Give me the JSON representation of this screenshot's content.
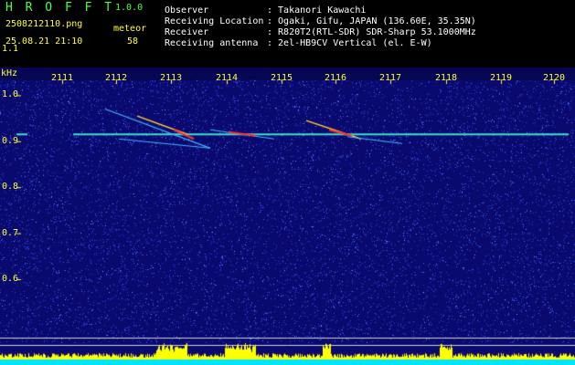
{
  "header": {
    "brand": "H R O F F T",
    "version": "1.0.0",
    "filename": "2508212110.png",
    "timestamp": "25.08.21 21:10",
    "type_label": "meteor",
    "count": "58",
    "info": [
      {
        "label": "Observer",
        "value": ": Takanori Kawachi"
      },
      {
        "label": "Receiving Location",
        "value": ": Ogaki, Gifu, JAPAN (136.60E, 35.35N)"
      },
      {
        "label": "Receiver",
        "value": ": R820T2(RTL-SDR) SDR-Sharp 53.1000MHz"
      },
      {
        "label": "Receiving antenna",
        "value": ": 2el-HB9CV Vertical (el. E-W)"
      }
    ]
  },
  "chart_data": {
    "type": "heatmap",
    "ylabel": "kHz",
    "x_ticks": [
      "2111",
      "2112",
      "2113",
      "2114",
      "2115",
      "2116",
      "2117",
      "2118",
      "2119",
      "2120"
    ],
    "y_ticks": [
      "1.1",
      "1.0",
      "0.9",
      "0.8",
      "0.7",
      "0.6"
    ],
    "ylim": [
      0.6,
      1.16
    ],
    "carrier_khz": 0.915,
    "colors": {
      "background": "#0a0a6e",
      "noise": "#3c5cff",
      "carrier": "#40e0d0",
      "strong": "#ff3030",
      "level": "#ffff00",
      "level_base": "#00e5ff"
    }
  }
}
